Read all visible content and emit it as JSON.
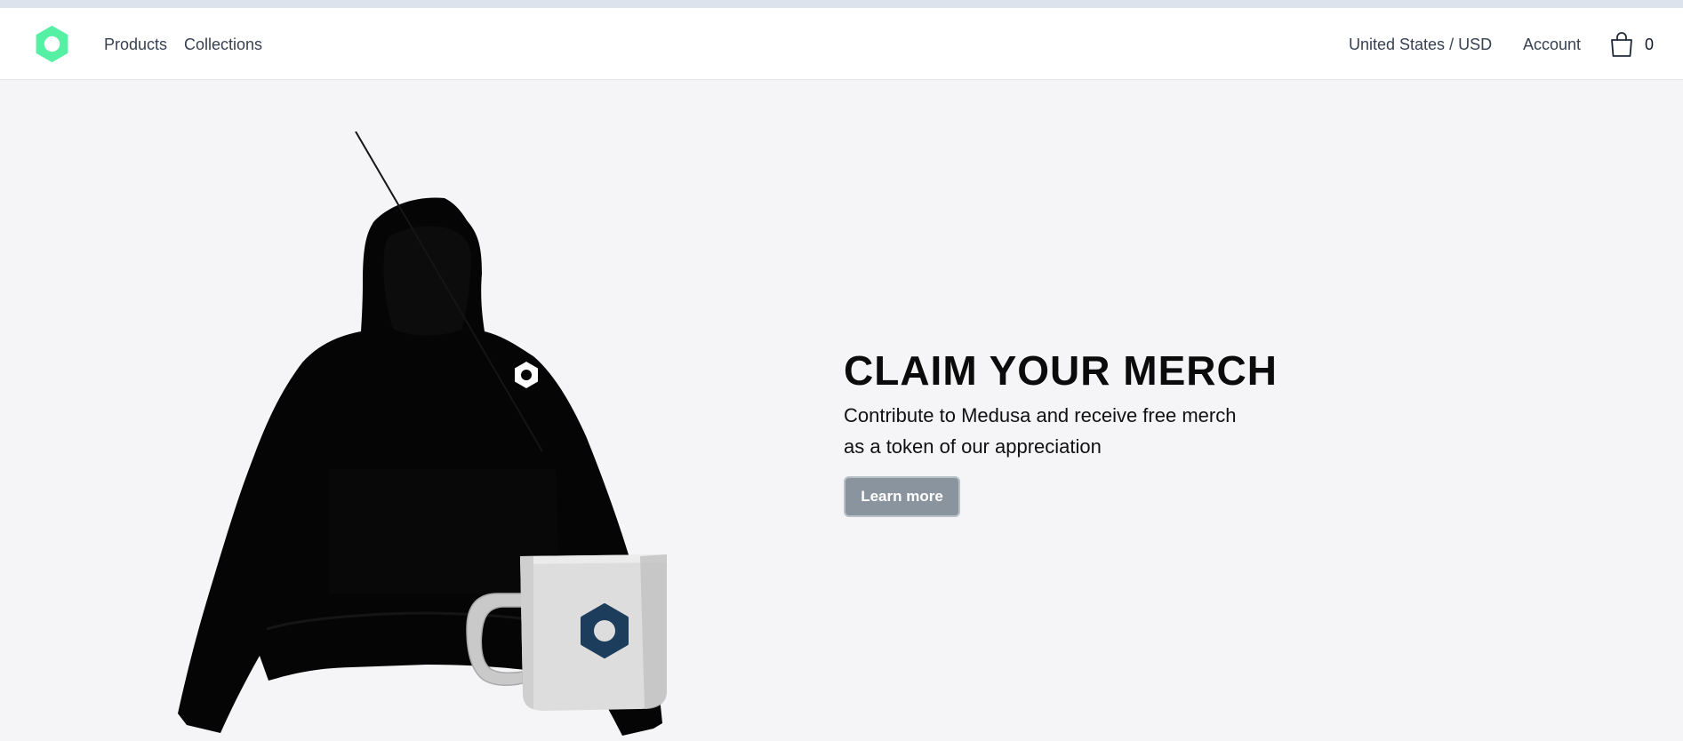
{
  "brand": {
    "logo_icon": "medusa-hexagon-logo-icon",
    "accent_color": "#56f0a4"
  },
  "nav": {
    "products": "Products",
    "collections": "Collections",
    "region": "United States / USD",
    "account": "Account",
    "cart_icon": "shopping-bag-icon",
    "cart_count": "0"
  },
  "hero": {
    "title": "CLAIM YOUR MERCH",
    "subtitle": "Contribute to Medusa and receive free merch as a token of our appreciation",
    "button_label": "Learn more",
    "image_subject": "black-hoodie-and-mug-icon",
    "button_color": "#8a949e"
  }
}
